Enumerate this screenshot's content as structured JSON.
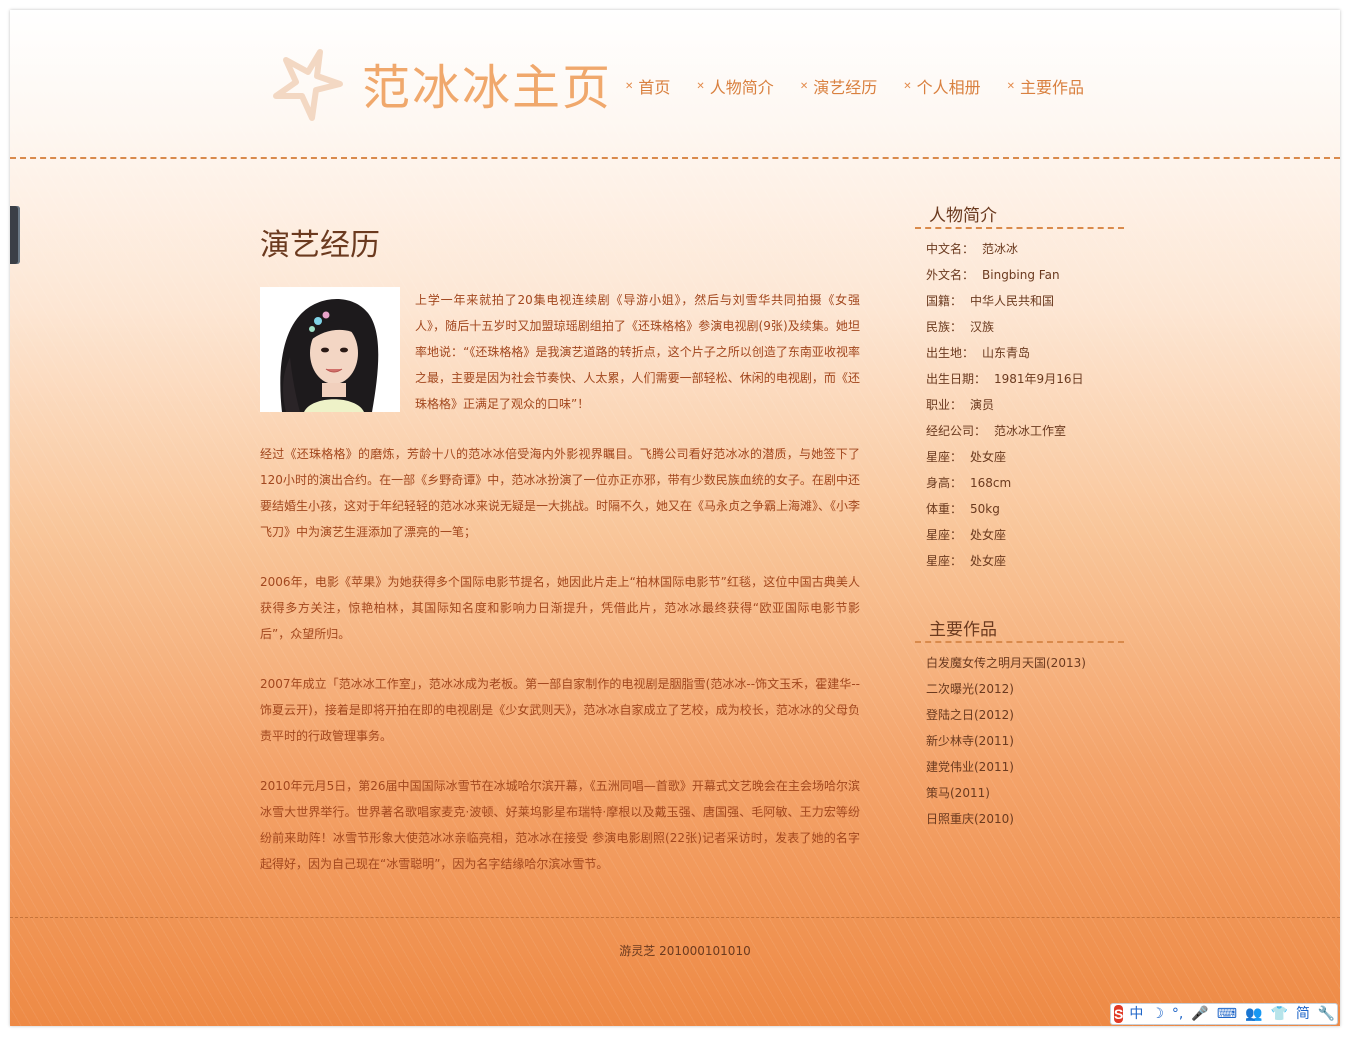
{
  "header": {
    "site_title": "范冰冰主页",
    "nav": [
      {
        "label": "首页"
      },
      {
        "label": "人物简介"
      },
      {
        "label": "演艺经历"
      },
      {
        "label": "个人相册"
      },
      {
        "label": "主要作品"
      }
    ],
    "nav_bullet": "✕"
  },
  "article": {
    "title": "演艺经历",
    "paragraphs": [
      "上学一年来就拍了20集电视连续剧《导游小姐》，然后与刘雪华共同拍摄《女强人》，随后十五岁时又加盟琼瑶剧组拍了《还珠格格》参演电视剧(9张)及续集。她坦率地说：“《还珠格格》是我演艺道路的转折点，这个片子之所以创造了东南亚收视率之最，主要是因为社会节奏快、人太累，人们需要一部轻松、休闲的电视剧，而《还珠格格》正满足了观众的口味”！",
      "经过《还珠格格》的磨炼，芳龄十八的范冰冰倍受海内外影视界瞩目。飞腾公司看好范冰冰的潜质，与她签下了120小时的演出合约。在一部《乡野奇谭》中，范冰冰扮演了一位亦正亦邪，带有少数民族血统的女子。在剧中还要结婚生小孩，这对于年纪轻轻的范冰冰来说无疑是一大挑战。时隔不久，她又在《马永贞之争霸上海滩》、《小李飞刀》中为演艺生涯添加了漂亮的一笔；",
      "2006年，电影《苹果》为她获得多个国际电影节提名，她因此片走上“柏林国际电影节”红毯，这位中国古典美人获得多方关注，惊艳柏林，其国际知名度和影响力日渐提升，凭借此片，范冰冰最终获得“欧亚国际电影节影后”，众望所归。",
      "2007年成立「范冰冰工作室」，范冰冰成为老板。第一部自家制作的电视剧是胭脂雪(范冰冰--饰文玉禾，霍建华--饰夏云开)，接着是即将开拍在即的电视剧是《少女武则天》，范冰冰自家成立了艺校，成为校长，范冰冰的父母负责平时的行政管理事务。",
      "2010年元月5日，第26届中国国际冰雪节在冰城哈尔滨开幕，《五洲同唱—首歌》开幕式文艺晚会在主会场哈尔滨冰雪大世界举行。世界著名歌唱家麦克·波顿、好莱坞影星布瑞特·摩根以及戴玉强、唐国强、毛阿敏、王力宏等纷纷前来助阵！冰雪节形象大使范冰冰亲临亮相，范冰冰在接受 参演电影剧照(22张)记者采访时，发表了她的名字起得好，因为自己现在“冰雪聪明”，因为名字结缘哈尔滨冰雪节。"
    ]
  },
  "sidebar": {
    "profile_heading": "人物简介",
    "profile": [
      {
        "key": "中文名：",
        "value": "范冰冰"
      },
      {
        "key": "外文名：",
        "value": "Bingbing Fan"
      },
      {
        "key": "国籍：",
        "value": "中华人民共和国"
      },
      {
        "key": "民族：",
        "value": "汉族"
      },
      {
        "key": "出生地：",
        "value": "山东青岛"
      },
      {
        "key": "出生日期：",
        "value": "1981年9月16日"
      },
      {
        "key": "职业：",
        "value": "演员"
      },
      {
        "key": "经纪公司：",
        "value": "范冰冰工作室"
      },
      {
        "key": "星座：",
        "value": "处女座"
      },
      {
        "key": "身高：",
        "value": "168cm"
      },
      {
        "key": "体重：",
        "value": "50kg"
      },
      {
        "key": "星座：",
        "value": "处女座"
      },
      {
        "key": "星座：",
        "value": "处女座"
      }
    ],
    "works_heading": "主要作品",
    "works": [
      "白发魔女传之明月天国(2013)",
      "二次曝光(2012)",
      "登陆之日(2012)",
      "新少林寺(2011)",
      "建党伟业(2011)",
      "策马(2011)",
      "日照重庆(2010)"
    ]
  },
  "footer": {
    "text": "游灵芝 201000101010"
  },
  "ime_toolbar": {
    "logo": "S",
    "items": [
      "中",
      "☽",
      "°,",
      "🎤",
      "⌨",
      "👥",
      "👕",
      "简",
      "🔧"
    ]
  },
  "colors": {
    "accent": "#f0a86c",
    "nav_text": "#d9803f",
    "body_text": "#a2471e",
    "heading_text": "#6b3a1f"
  }
}
